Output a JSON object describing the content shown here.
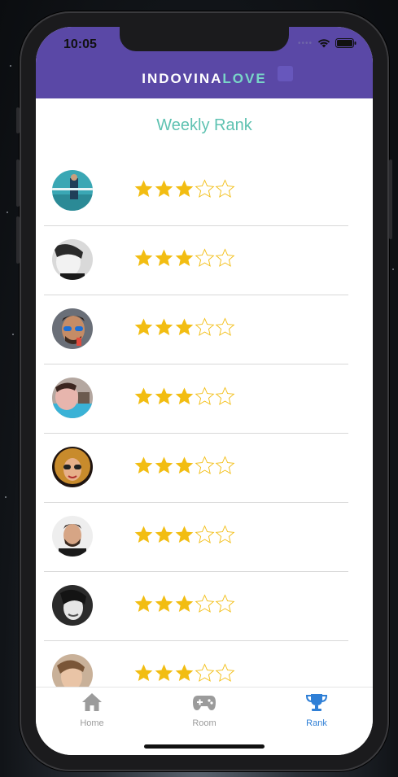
{
  "status_bar": {
    "time": "10:05"
  },
  "header": {
    "logo_part1": "INDOVINA",
    "logo_part2": "LOVE"
  },
  "page": {
    "title": "Weekly Rank"
  },
  "rank": {
    "max_rating": 5,
    "entries": [
      {
        "rating": 3
      },
      {
        "rating": 3
      },
      {
        "rating": 3
      },
      {
        "rating": 3
      },
      {
        "rating": 3
      },
      {
        "rating": 3
      },
      {
        "rating": 3
      },
      {
        "rating": 3
      }
    ]
  },
  "tabbar": {
    "tabs": [
      {
        "label": "Home",
        "icon": "home-icon",
        "active": false
      },
      {
        "label": "Room",
        "icon": "gamepad-icon",
        "active": false
      },
      {
        "label": "Rank",
        "icon": "trophy-icon",
        "active": true
      }
    ]
  },
  "colors": {
    "header_bg": "#5a48a6",
    "title": "#5ec2b1",
    "star_filled": "#f2bd12",
    "tab_active": "#2f7fd6",
    "tab_inactive": "#9b9b9b"
  }
}
